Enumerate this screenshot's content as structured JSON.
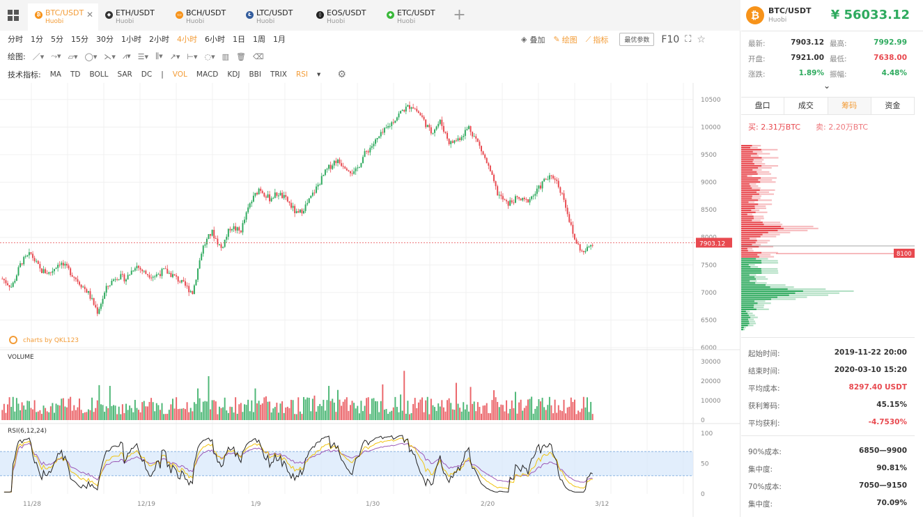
{
  "tabs": [
    {
      "pair": "BTC/USDT",
      "exchange": "Huobi",
      "icon": "bitcoin-icon",
      "color": "#f7931a",
      "glyph": "₿",
      "active": true
    },
    {
      "pair": "ETH/USDT",
      "exchange": "Huobi",
      "icon": "ethereum-icon",
      "color": "#333333",
      "glyph": "◆",
      "active": false
    },
    {
      "pair": "BCH/USDT",
      "exchange": "Huobi",
      "icon": "bitcoin-cash-icon",
      "color": "#f7931a",
      "glyph": "▭",
      "active": false
    },
    {
      "pair": "LTC/USDT",
      "exchange": "Huobi",
      "icon": "litecoin-icon",
      "color": "#345d9d",
      "glyph": "Ł",
      "active": false
    },
    {
      "pair": "EOS/USDT",
      "exchange": "Huobi",
      "icon": "eos-icon",
      "color": "#222222",
      "glyph": "◊",
      "active": false
    },
    {
      "pair": "ETC/USDT",
      "exchange": "Huobi",
      "icon": "etc-icon",
      "color": "#3ab83a",
      "glyph": "◆",
      "active": false
    }
  ],
  "timeframes": [
    "分时",
    "1分",
    "5分",
    "15分",
    "30分",
    "1小时",
    "2小时",
    "4小时",
    "6小时",
    "1日",
    "1周",
    "1月"
  ],
  "active_timeframe": "4小时",
  "toolbar_right": {
    "overlay": "叠加",
    "draw": "绘图",
    "indicator": "指标",
    "best_params": "最优参数",
    "f10": "F10"
  },
  "draw_label": "绘图:",
  "tech_label": "技术指标:",
  "indicators": [
    "MA",
    "TD",
    "BOLL",
    "SAR",
    "DC",
    "|",
    "VOL",
    "MACD",
    "KDJ",
    "BBI",
    "TRIX",
    "RSI"
  ],
  "active_indicators": [
    "VOL",
    "RSI"
  ],
  "chart": {
    "watermark": "charts by QKL123",
    "current_price_tag": "7903.12",
    "marker_tag": "8100",
    "price_ticks": [
      "10500",
      "10000",
      "9500",
      "9000",
      "8500",
      "8000",
      "7500",
      "7000",
      "6500",
      "6000"
    ],
    "volume_label": "VOLUME",
    "volume_ticks": [
      "30000",
      "20000",
      "10000",
      "0"
    ],
    "rsi_label": "RSI(6,12,24)",
    "rsi_ticks": [
      "100",
      "50",
      "0"
    ],
    "date_ticks": [
      "11/28",
      "12/19",
      "1/9",
      "1/30",
      "2/20",
      "3/12"
    ],
    "up_color": "#2eaa5e",
    "down_color": "#e8494f"
  },
  "chart_data": {
    "type": "candlestick",
    "ylim": [
      6000,
      10700
    ],
    "close_path": [
      7250,
      7100,
      7550,
      7700,
      7400,
      7350,
      7550,
      7400,
      7200,
      7000,
      6650,
      7100,
      7300,
      7250,
      7500,
      7350,
      7300,
      7400,
      7300,
      7150,
      7000,
      7800,
      8100,
      7800,
      8200,
      8100,
      8600,
      8900,
      8700,
      8800,
      8650,
      8400,
      8600,
      8900,
      9200,
      9400,
      9300,
      9150,
      9500,
      9700,
      9900,
      10100,
      10300,
      10400,
      10200,
      9900,
      10100,
      9700,
      9800,
      10000,
      9700,
      9300,
      8800,
      8600,
      8700,
      8650,
      8800,
      9050,
      9100,
      8700,
      8000,
      7700,
      7903
    ],
    "rsi_bands": [
      30,
      70
    ]
  },
  "side": {
    "pair": "BTC/USDT",
    "exchange": "Huobi",
    "price": "¥ 56033.12",
    "stats": [
      {
        "k": "最新:",
        "v": "7903.12",
        "k2": "最高:",
        "v2": "7992.99",
        "c2": "#2eaa5e"
      },
      {
        "k": "开盘:",
        "v": "7921.00",
        "k2": "最低:",
        "v2": "7638.00",
        "c2": "#e8494f"
      },
      {
        "k": "涨跌:",
        "v": "1.89%",
        "k2": "振幅:",
        "v2": "4.48%",
        "c1": "#2eaa5e",
        "c2": "#2eaa5e"
      }
    ],
    "subtabs": [
      "盘口",
      "成交",
      "筹码",
      "资金"
    ],
    "active_subtab": "筹码",
    "buy": "买: 2.31万BTC",
    "sell": "卖: 2.20万BTC",
    "info1": [
      {
        "k": "起始时间:",
        "v": "2019-11-22 20:00"
      },
      {
        "k": "结束时间:",
        "v": "2020-03-10 15:20"
      },
      {
        "k": "平均成本:",
        "v": "8297.40 USDT",
        "color": "#e8494f"
      },
      {
        "k": "获利筹码:",
        "v": "45.15%"
      },
      {
        "k": "平均获利:",
        "v": "-4.7530%",
        "color": "#e8494f"
      }
    ],
    "info2": [
      {
        "k": "90%成本:",
        "v": "6850—9900"
      },
      {
        "k": "集中度:",
        "v": "90.81%"
      },
      {
        "k": "70%成本:",
        "v": "7050—9150"
      },
      {
        "k": "集中度:",
        "v": "70.09%"
      }
    ]
  }
}
